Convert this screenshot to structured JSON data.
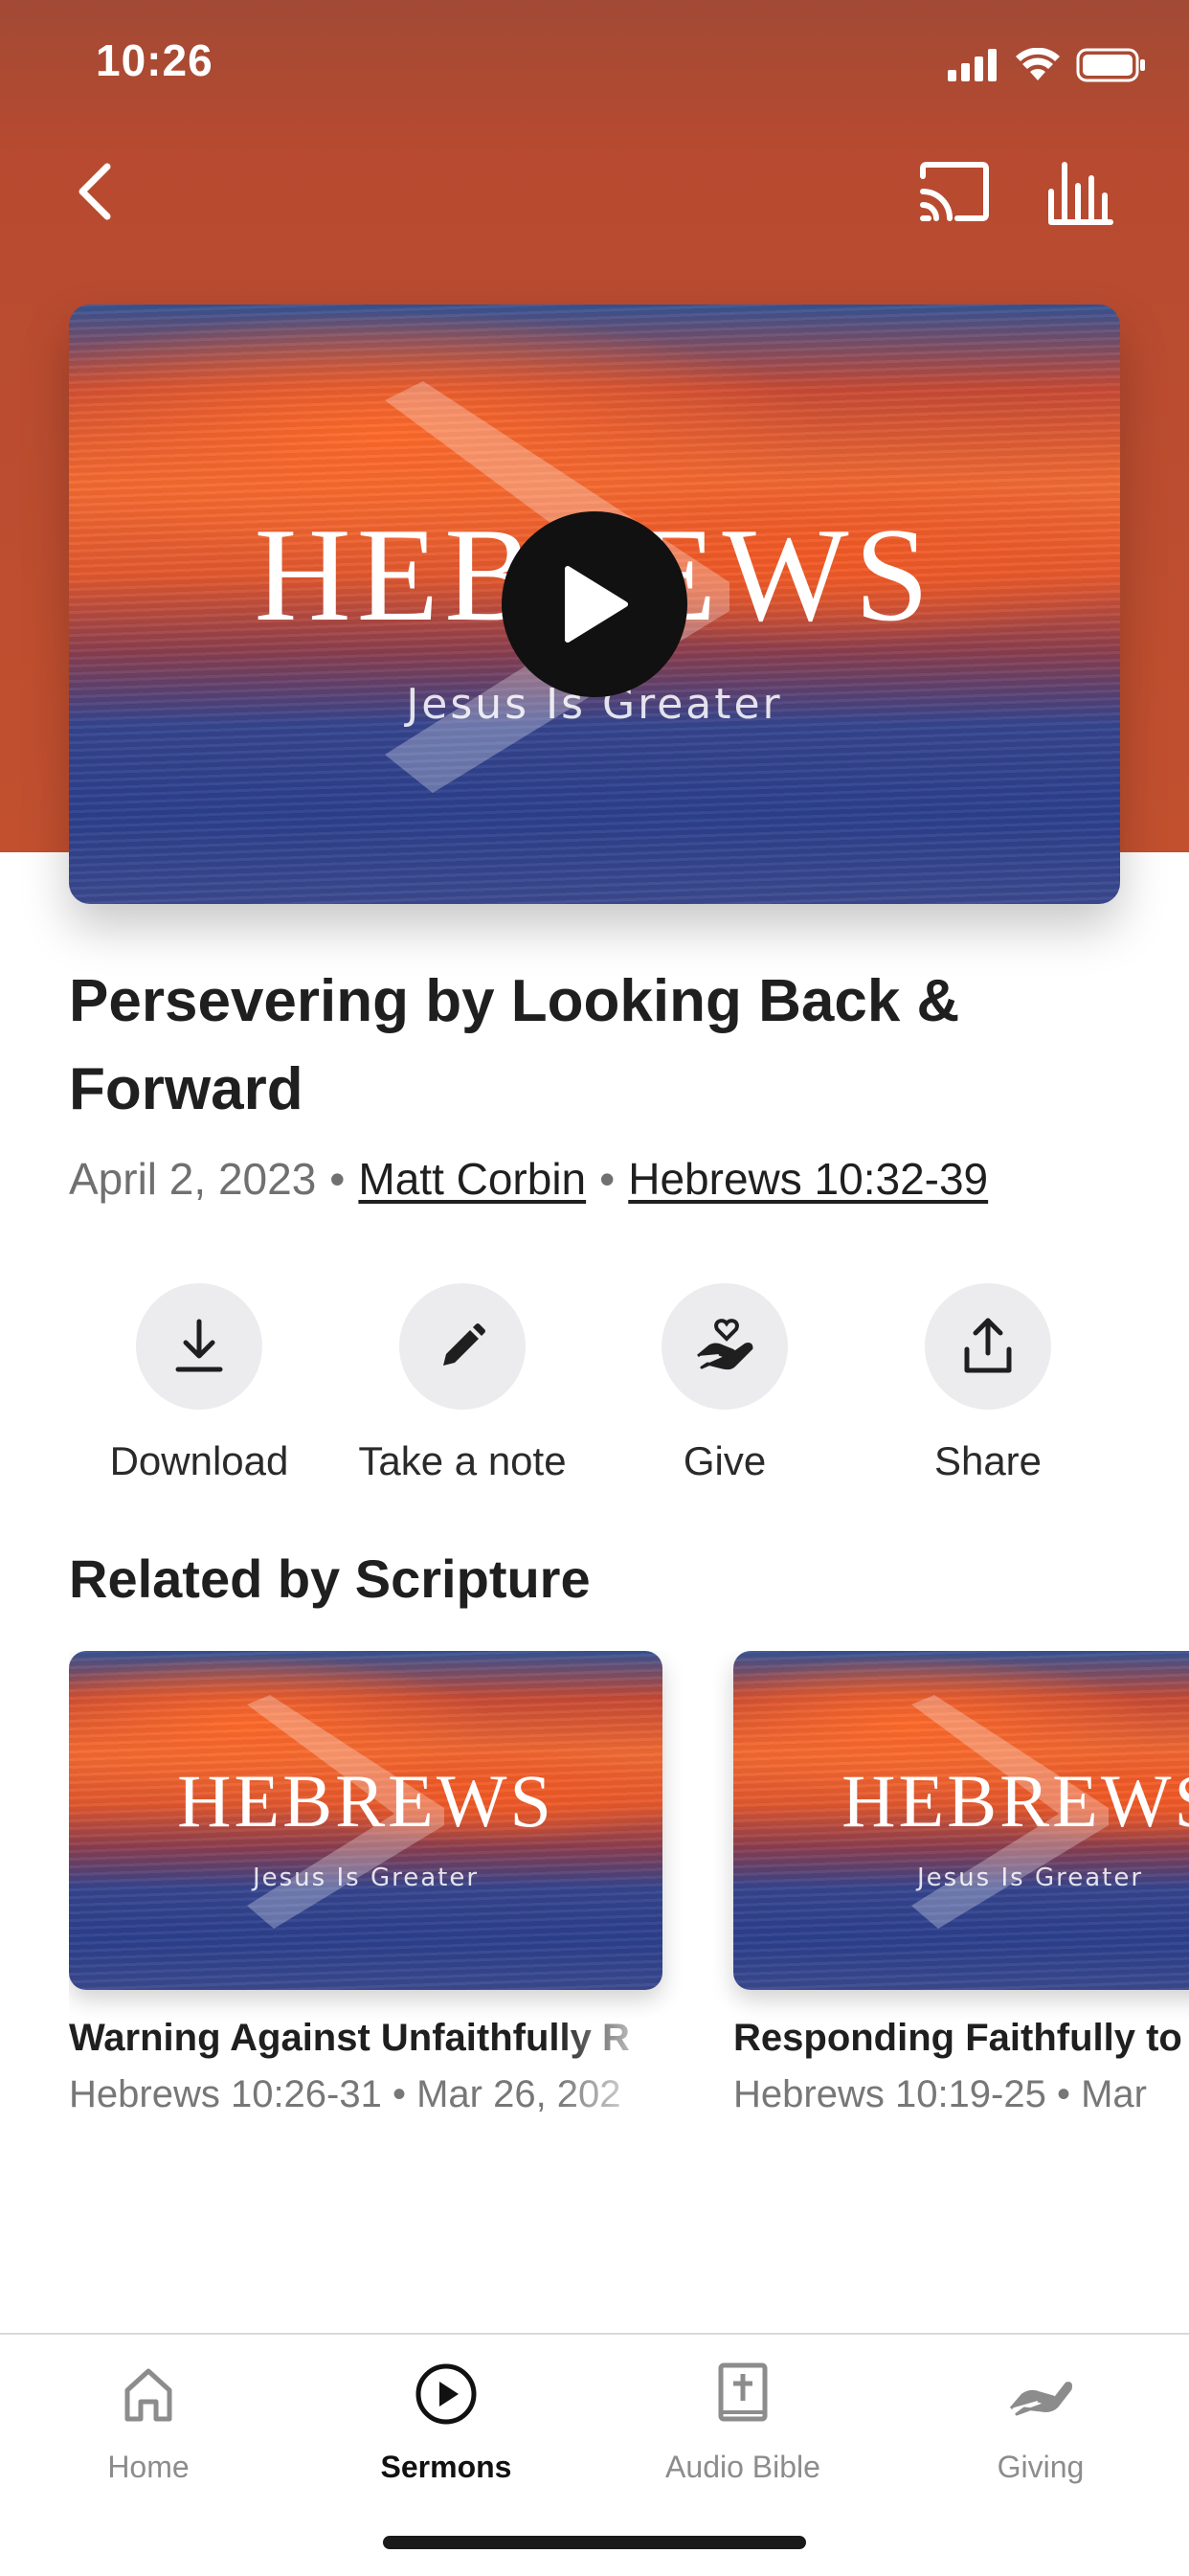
{
  "status_bar": {
    "time": "10:26"
  },
  "colors": {
    "header": "#b84b30",
    "accent": "#111111",
    "muted": "#8c8c8c"
  },
  "nav": {
    "back_icon": "chevron-left-icon",
    "cast_icon": "cast-icon",
    "equalizer_icon": "equalizer-icon"
  },
  "artwork": {
    "title": "HEBREWS",
    "subtitle": "Jesus Is Greater"
  },
  "sermon": {
    "title": "Persevering by Looking Back & Forward",
    "date": "April 2, 2023",
    "speaker": "Matt Corbin",
    "scripture": "Hebrews 10:32-39",
    "separator": "•"
  },
  "actions": [
    {
      "label": "Download",
      "icon": "download-icon"
    },
    {
      "label": "Take a note",
      "icon": "pencil-icon"
    },
    {
      "label": "Give",
      "icon": "give-heart-hand-icon"
    },
    {
      "label": "Share",
      "icon": "share-icon"
    }
  ],
  "related": {
    "heading": "Related by Scripture",
    "items": [
      {
        "title": "Warning Against Unfaithfully R",
        "meta": "Hebrews 10:26-31 • Mar 26, 202",
        "art_title": "HEBREWS",
        "art_subtitle": "Jesus Is Greater"
      },
      {
        "title": "Responding Faithfully to",
        "meta": "Hebrews 10:19-25 • Mar",
        "art_title": "HEBREWS",
        "art_subtitle": "Jesus Is Greater"
      }
    ]
  },
  "tabs": [
    {
      "label": "Home",
      "icon": "home-icon",
      "active": false
    },
    {
      "label": "Sermons",
      "icon": "play-circle-icon",
      "active": true
    },
    {
      "label": "Audio Bible",
      "icon": "bible-icon",
      "active": false
    },
    {
      "label": "Giving",
      "icon": "giving-hand-icon",
      "active": false
    }
  ]
}
